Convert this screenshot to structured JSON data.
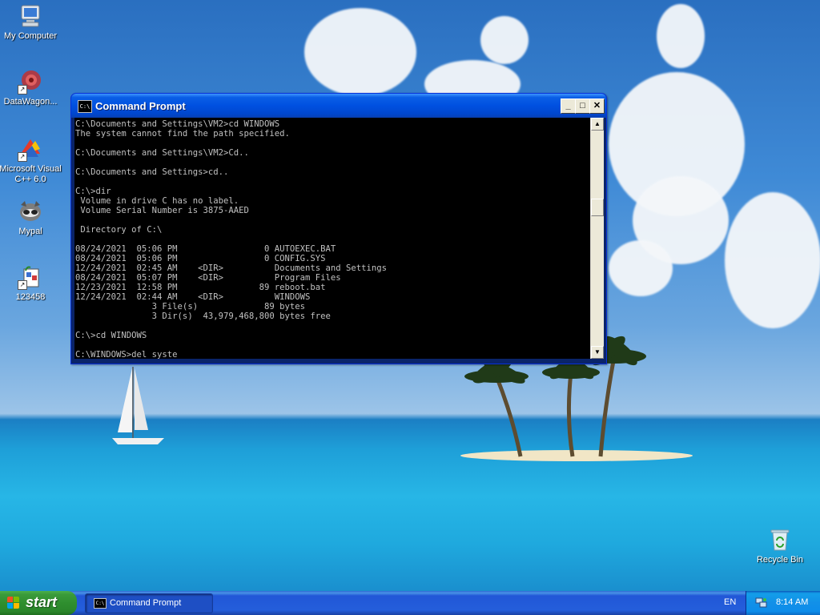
{
  "desktop": {
    "icons": [
      {
        "label": "My Computer",
        "icon": "my-computer-icon"
      },
      {
        "label": "DataWagon...",
        "icon": "datawagon-icon"
      },
      {
        "label": "Microsoft Visual C++ 6.0",
        "icon": "visual-cpp-icon"
      },
      {
        "label": "Mypal",
        "icon": "mypal-icon"
      },
      {
        "label": "123458",
        "icon": "file-icon"
      },
      {
        "label": "Recycle Bin",
        "icon": "recycle-bin-icon"
      }
    ]
  },
  "cmd_window": {
    "title": "Command Prompt",
    "icon_text": "C:\\",
    "output": "C:\\Documents and Settings\\VM2>cd WINDOWS\nThe system cannot find the path specified.\n\nC:\\Documents and Settings\\VM2>Cd..\n\nC:\\Documents and Settings>cd..\n\nC:\\>dir\n Volume in drive C has no label.\n Volume Serial Number is 3875-AAED\n\n Directory of C:\\\n\n08/24/2021  05:06 PM                 0 AUTOEXEC.BAT\n08/24/2021  05:06 PM                 0 CONFIG.SYS\n12/24/2021  02:45 AM    <DIR>          Documents and Settings\n08/24/2021  05:07 PM    <DIR>          Program Files\n12/23/2021  12:58 PM                89 reboot.bat\n12/24/2021  02:44 AM    <DIR>          WINDOWS\n               3 File(s)             89 bytes\n               3 Dir(s)  43,979,468,800 bytes free\n\nC:\\>cd WINDOWS\n\nC:\\WINDOWS>del syste",
    "buttons": {
      "minimize": "_",
      "maximize": "□",
      "close": "✕"
    },
    "scroll_up": "▲",
    "scroll_down": "▼"
  },
  "taskbar": {
    "start_label": "start",
    "tasks": [
      {
        "label": "Command Prompt",
        "icon_text": "C:\\"
      }
    ],
    "language": "EN",
    "clock": "8:14 AM"
  },
  "colors": {
    "console_bg": "#000000",
    "console_text": "#c0c0c0",
    "titlebar": "#0054e3",
    "taskbar": "#245edb",
    "start_green": "#3a9a3a"
  }
}
